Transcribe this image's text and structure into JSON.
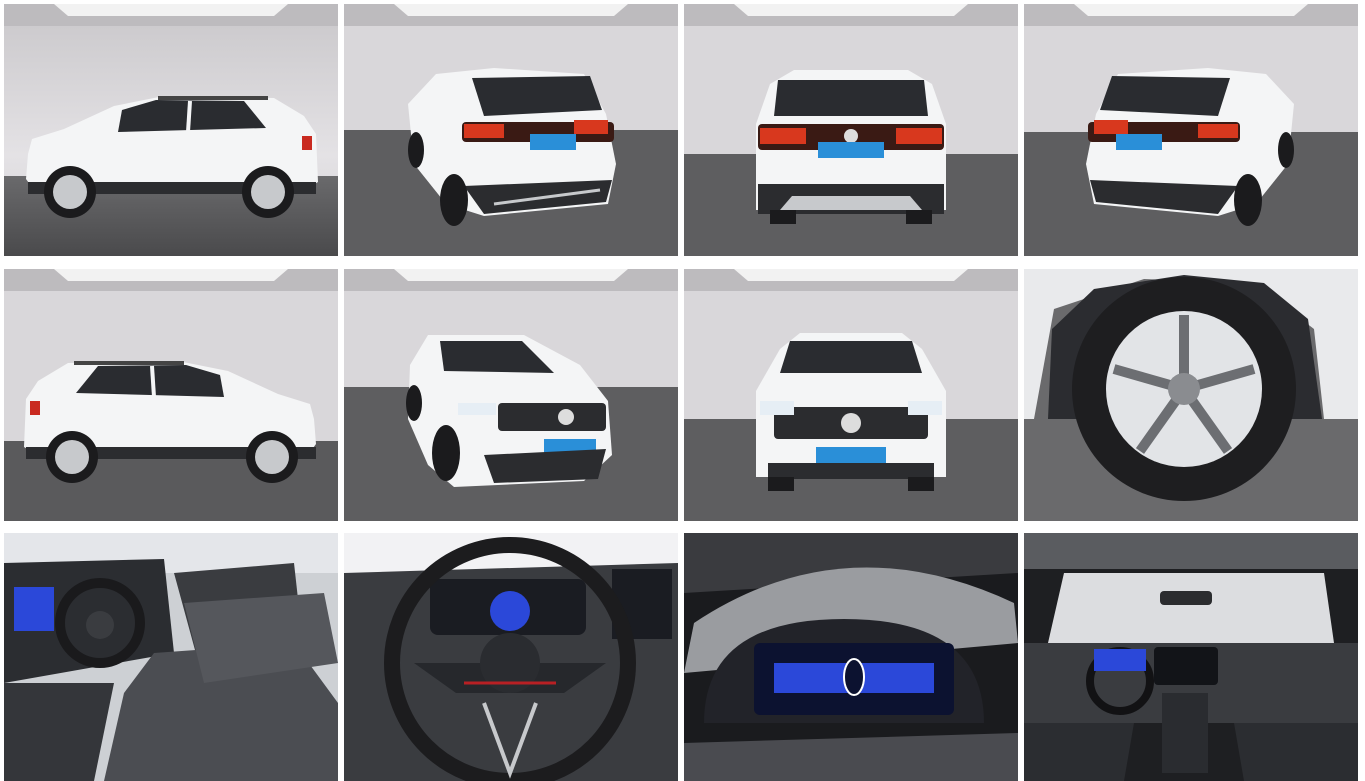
{
  "gallery": {
    "tiles": [
      {
        "view": "side-left",
        "label": ""
      },
      {
        "view": "rear-three-quarter-left",
        "label": ""
      },
      {
        "view": "rear",
        "label": ""
      },
      {
        "view": "rear-three-quarter-right",
        "label": ""
      },
      {
        "view": "side-right",
        "label": ""
      },
      {
        "view": "front-three-quarter-left",
        "label": ""
      },
      {
        "view": "front",
        "label": ""
      },
      {
        "view": "wheel-closeup",
        "label": ""
      },
      {
        "view": "interior-driver-seat",
        "label": ""
      },
      {
        "view": "steering-wheel",
        "label": ""
      },
      {
        "view": "digital-cockpit",
        "label": ""
      },
      {
        "view": "dashboard-rear-view",
        "label": ""
      }
    ],
    "colors": {
      "car_body": "#f4f5f6",
      "studio_wall": "#d9d7da",
      "studio_floor": "#5a5a5c",
      "plate_blue": "#2a8fd8",
      "tail_light": "#d8381e",
      "interior_dark": "#2b2d31",
      "display_blue": "#2b48d9"
    }
  }
}
